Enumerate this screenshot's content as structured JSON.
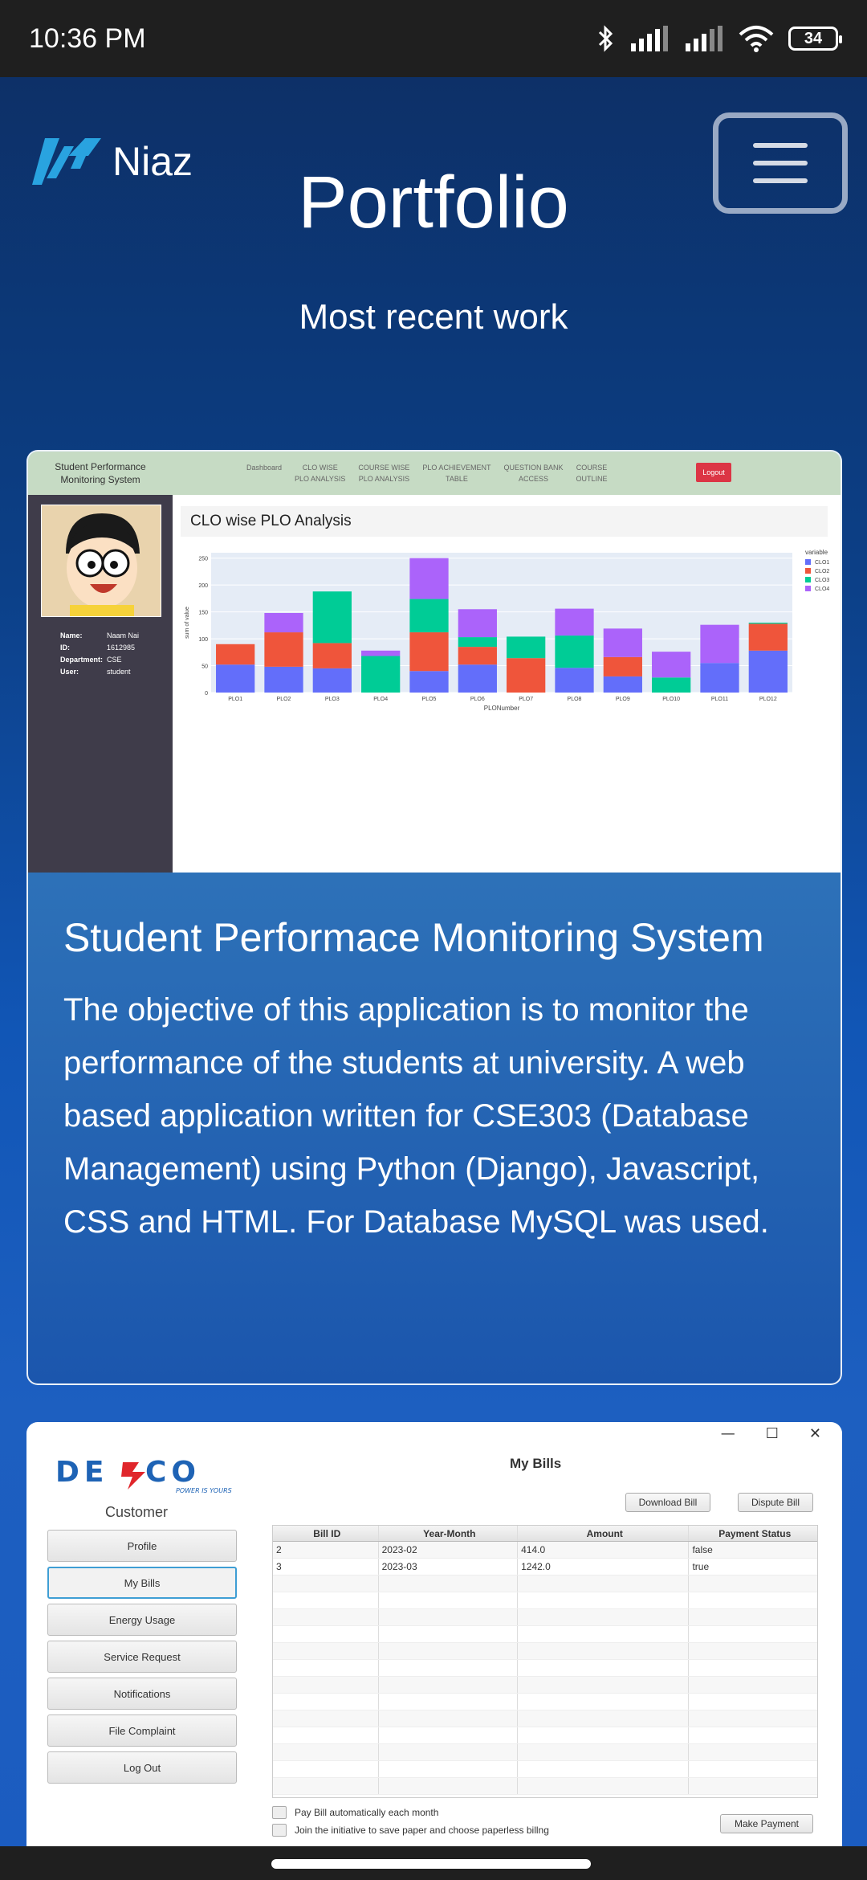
{
  "status_bar": {
    "time": "10:36 PM",
    "battery": "34"
  },
  "header": {
    "brand": "Niaz",
    "title": "Portfolio",
    "subtitle": "Most recent work"
  },
  "project1": {
    "title": "Student Performace Monitoring System",
    "description": "The objective of this application is to monitor the performance of the students at university. A web based application written for CSE303 (Database Management) using Python (Django), Javascript, CSS and HTML. For Database MySQL was used.",
    "screenshot": {
      "system_name_1": "Student Performance",
      "system_name_2": "Monitoring System",
      "nav": [
        {
          "l1": "Dashboard",
          "l2": ""
        },
        {
          "l1": "CLO WISE",
          "l2": "PLO ANALYSIS"
        },
        {
          "l1": "COURSE WISE",
          "l2": "PLO ANALYSIS"
        },
        {
          "l1": "PLO ACHIEVEMENT",
          "l2": "TABLE"
        },
        {
          "l1": "QUESTION BANK",
          "l2": "ACCESS"
        },
        {
          "l1": "COURSE",
          "l2": "OUTLINE"
        }
      ],
      "logout": "Logout",
      "profile": [
        {
          "k": "Name:",
          "v": "Naam Nai"
        },
        {
          "k": "ID:",
          "v": "1612985"
        },
        {
          "k": "Department:",
          "v": "CSE"
        },
        {
          "k": "User:",
          "v": "student"
        }
      ],
      "chart_heading": "CLO wise PLO Analysis"
    }
  },
  "chart_data": {
    "type": "bar",
    "stacked": true,
    "title": "",
    "xlabel": "PLONumber",
    "ylabel": "sum of value",
    "legend_title": "variable",
    "legend_position": "right",
    "ylim": [
      0,
      260
    ],
    "yticks": [
      0,
      50,
      100,
      150,
      200,
      250
    ],
    "categories": [
      "PLO1",
      "PLO2",
      "PLO3",
      "PLO4",
      "PLO5",
      "PLO6",
      "PLO7",
      "PLO8",
      "PLO9",
      "PLO10",
      "PLO11",
      "PLO12"
    ],
    "series": [
      {
        "name": "CLO1",
        "color": "#636efa",
        "values": [
          52,
          48,
          45,
          0,
          40,
          52,
          0,
          46,
          30,
          0,
          55,
          78
        ]
      },
      {
        "name": "CLO2",
        "color": "#ef553b",
        "values": [
          38,
          64,
          47,
          0,
          72,
          33,
          64,
          0,
          36,
          0,
          0,
          50
        ]
      },
      {
        "name": "CLO3",
        "color": "#00cc96",
        "values": [
          0,
          0,
          96,
          68,
          62,
          18,
          40,
          60,
          0,
          28,
          0,
          2
        ]
      },
      {
        "name": "CLO4",
        "color": "#ab63fa",
        "values": [
          0,
          36,
          0,
          10,
          76,
          52,
          0,
          50,
          53,
          48,
          71,
          0
        ]
      }
    ]
  },
  "project2": {
    "app_title": "My Bills",
    "logo_text": "DESCO",
    "logo_tagline": "POWER IS YOURS",
    "customer_label": "Customer",
    "menu": [
      "Profile",
      "My Bills",
      "Energy Usage",
      "Service Request",
      "Notifications",
      "File Complaint",
      "Log Out"
    ],
    "download_bill": "Download Bill",
    "dispute_bill": "Dispute Bill",
    "columns": [
      "Bill ID",
      "Year-Month",
      "Amount",
      "Payment Status"
    ],
    "rows": [
      [
        "2",
        "2023-02",
        "414.0",
        "false"
      ],
      [
        "3",
        "2023-03",
        "1242.0",
        "true"
      ]
    ],
    "auto_pay": "Pay Bill automatically each month",
    "paperless": "Join the initiative to save paper and choose paperless billng",
    "make_payment": "Make Payment"
  },
  "colors": {
    "desco_blue": "#1e63b5",
    "desco_red": "#e0262b",
    "logout_red": "#dc3545"
  }
}
